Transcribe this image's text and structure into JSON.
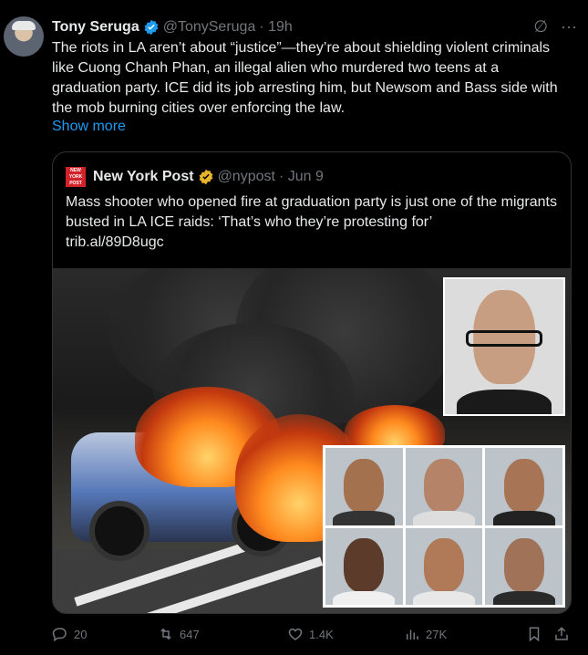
{
  "author": {
    "name": "Tony Seruga",
    "handle": "@TonySeruga",
    "time": "· 19h"
  },
  "tweet_text": "The riots in LA aren’t about “justice”—they’re about shielding violent criminals like Cuong Chanh Phan, an illegal alien who murdered two teens at a graduation party. ICE did its job arresting him, but Newsom and Bass side with the mob burning cities over enforcing the law.",
  "show_more": "Show more",
  "quote": {
    "logo_text": "NEW YORK POST",
    "name": "New York Post",
    "handle": "@nypost",
    "time": "· Jun 9",
    "text": "Mass shooter who opened fire at graduation party is just one of the migrants busted in LA ICE raids: ‘That’s who they’re protesting for’",
    "link": "trib.al/89D8ugc"
  },
  "actions": {
    "replies": "20",
    "reposts": "647",
    "likes": "1.4K",
    "views": "27K"
  },
  "icons": [
    "verified-badge-icon",
    "grok-icon",
    "more-icon",
    "reply-icon",
    "repost-icon",
    "like-icon",
    "views-icon",
    "bookmark-icon",
    "share-icon"
  ],
  "colors": {
    "accent": "#1d9bf0",
    "verified_gold": "#e8b42b",
    "muted": "#71767b",
    "nypost_red": "#d2232a"
  }
}
